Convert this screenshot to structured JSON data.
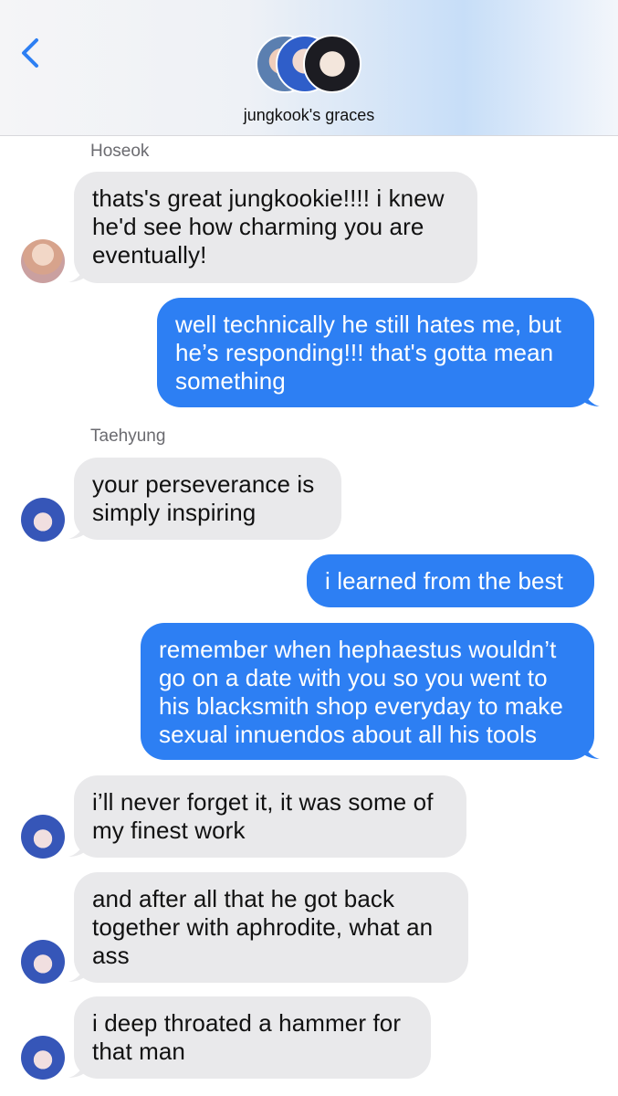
{
  "header": {
    "title": "jungkook's graces",
    "back_icon": "chevron-left-icon",
    "accent": "#2d7ff3"
  },
  "messages": [
    {
      "type": "sender",
      "text": "Hoseok"
    },
    {
      "type": "incoming",
      "text": "thats's great jungkookie!!!! i knew\nhe'd see how charming you are\neventually!",
      "avatar": "Hoseok"
    },
    {
      "type": "outgoing",
      "text": "well technically he still hates me, but\nhe’s responding!!! that's gotta mean\nsomething"
    },
    {
      "type": "sender",
      "text": "Taehyung"
    },
    {
      "type": "incoming",
      "text": "your perseverance is\nsimply inspiring",
      "avatar": "Taehyung"
    },
    {
      "type": "outgoing",
      "text": "i learned from the best"
    },
    {
      "type": "outgoing",
      "text": "remember when hephaestus wouldn’t\ngo on a date with you so you went to\nhis blacksmith shop everyday to make\nsexual innuendos about all his tools"
    },
    {
      "type": "incoming",
      "text": "i’ll never forget it, it was some of\nmy finest work",
      "avatar": "Taehyung"
    },
    {
      "type": "incoming",
      "text": "and after all that he got back\ntogether with aphrodite, what an\nass",
      "avatar": "Taehyung"
    },
    {
      "type": "incoming",
      "text": "i deep throated a hammer for\nthat man",
      "avatar": "Taehyung"
    }
  ]
}
